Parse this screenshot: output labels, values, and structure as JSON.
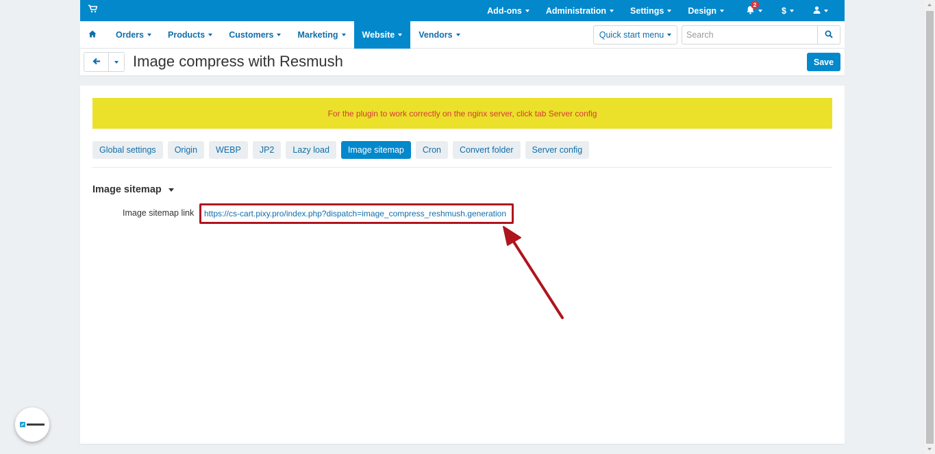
{
  "topbar": {
    "items": [
      {
        "label": "Add-ons"
      },
      {
        "label": "Administration"
      },
      {
        "label": "Settings"
      },
      {
        "label": "Design"
      }
    ],
    "notifications_count": "2",
    "currency_label": "$"
  },
  "mainnav": {
    "items": [
      {
        "label": "Orders"
      },
      {
        "label": "Products"
      },
      {
        "label": "Customers"
      },
      {
        "label": "Marketing"
      },
      {
        "label": "Website",
        "active": true
      },
      {
        "label": "Vendors"
      }
    ],
    "quick_start_label": "Quick start menu",
    "search_placeholder": "Search"
  },
  "page": {
    "title": "Image compress with Resmush",
    "save_label": "Save"
  },
  "notice": "For the plugin to work correctly on the nginx server, click tab Server config",
  "tabs": [
    {
      "label": "Global settings"
    },
    {
      "label": "Origin"
    },
    {
      "label": "WEBP"
    },
    {
      "label": "JP2"
    },
    {
      "label": "Lazy load"
    },
    {
      "label": "Image sitemap",
      "active": true
    },
    {
      "label": "Cron"
    },
    {
      "label": "Convert folder"
    },
    {
      "label": "Server config"
    }
  ],
  "section": {
    "title": "Image sitemap",
    "field_label": "Image sitemap link",
    "link": "https://cs-cart.pixy.pro/index.php?dispatch=image_compress_reshmush.generation"
  },
  "colors": {
    "brand": "#0388cc",
    "notice_bg": "#ebe12a",
    "notice_text": "#d9363e",
    "highlight": "#b0141e"
  }
}
